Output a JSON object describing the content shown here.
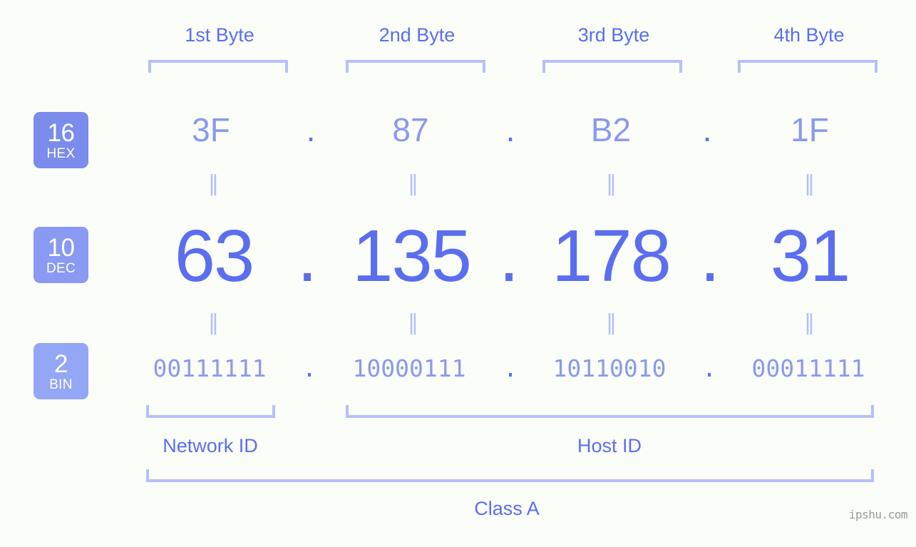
{
  "header": {
    "byte_labels": [
      "1st Byte",
      "2nd Byte",
      "3rd Byte",
      "4th Byte"
    ]
  },
  "bases": [
    {
      "number": "16",
      "name": "HEX",
      "color": "#7b8cec"
    },
    {
      "number": "10",
      "name": "DEC",
      "color": "#8a99f1"
    },
    {
      "number": "2",
      "name": "BIN",
      "color": "#94a6f6"
    }
  ],
  "rows": {
    "hex": {
      "values": [
        "3F",
        "87",
        "B2",
        "1F"
      ],
      "separator": "."
    },
    "dec": {
      "values": [
        "63",
        "135",
        "178",
        "31"
      ],
      "separator": "."
    },
    "bin": {
      "values": [
        "00111111",
        "10000111",
        "10110010",
        "00011111"
      ],
      "separator": "."
    }
  },
  "equals": {
    "glyph": "‖"
  },
  "sections": {
    "network_id": "Network ID",
    "host_id": "Host ID",
    "class": "Class A"
  },
  "watermark": "ipshu.com",
  "colors": {
    "background": "#fbfdf9",
    "accent_strong": "#5b6ef0",
    "accent_mid": "#8a99f1",
    "accent_light": "#b5c0fb"
  }
}
